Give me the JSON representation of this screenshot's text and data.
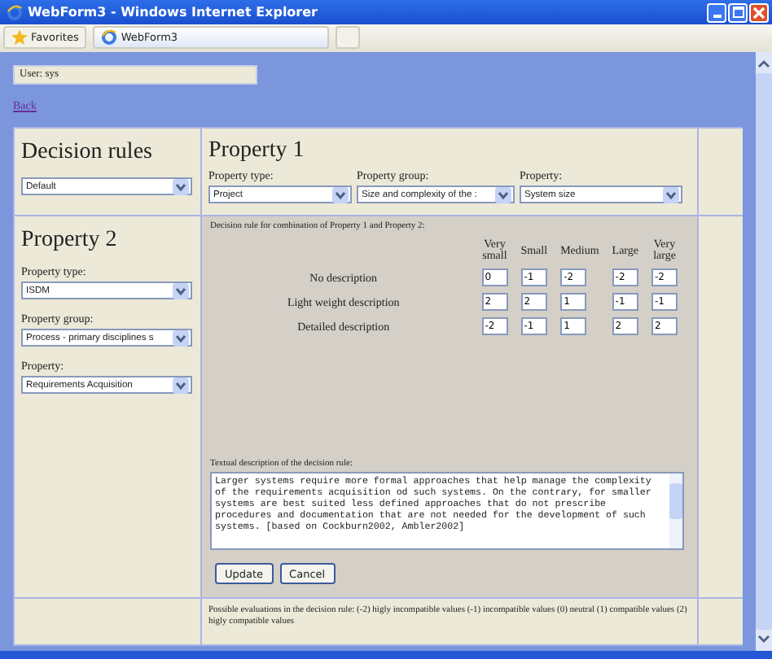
{
  "window": {
    "title": "WebForm3 - Windows Internet Explorer"
  },
  "toolbar": {
    "favorites": "Favorites",
    "tabs": [
      {
        "label": "WebForm3",
        "selected": true
      }
    ]
  },
  "user_field": {
    "value": "User: sys"
  },
  "back_link": "Back",
  "decision_rules": {
    "title": "Decision rules",
    "value": "Default"
  },
  "property_1": {
    "title": "Property 1",
    "fields": [
      {
        "label": "Property type:",
        "value": "Project"
      },
      {
        "label": "Property group:",
        "value": "Size and complexity of the :"
      },
      {
        "label": "Property:",
        "value": "System size"
      }
    ]
  },
  "property_2": {
    "title": "Property 2",
    "fields": [
      {
        "label": "Property type:",
        "value": "ISDM"
      },
      {
        "label": "Property group:",
        "value": "Process - primary disciplines s"
      },
      {
        "label": "Property:",
        "value": "Requirements Acquisition"
      }
    ]
  },
  "matrix": {
    "caption": "Decision rule for combination of Property 1 and Property 2:",
    "columns": [
      "Very small",
      "Small",
      "Medium",
      "Large",
      "Very large"
    ],
    "rows": [
      {
        "label": "No description",
        "values": [
          "0",
          "-1",
          "-2",
          "-2",
          "-2"
        ]
      },
      {
        "label": "Light weight description",
        "values": [
          "2",
          "2",
          "1",
          "-1",
          "-1"
        ]
      },
      {
        "label": "Detailed description",
        "values": [
          "-2",
          "-1",
          "1",
          "2",
          "2"
        ]
      }
    ]
  },
  "description": {
    "label": "Textual description of the decision rule:",
    "text": "Larger systems require more formal approaches that help manage the complexity of the requirements acquisition od such systems. On the contrary, for smaller systems are best suited less defined approaches that do not prescribe procedures and documentation that are not needed for the development of such systems. [based on Cockburn2002, Ambler2002]"
  },
  "buttons": [
    "Update",
    "Cancel"
  ],
  "footer": "Possible evaluations in the decision rule:  (-2) higly incompatible values  (-1) incompatible values  (0) neutral  (1) compatible values  (2) higly compatible values"
}
